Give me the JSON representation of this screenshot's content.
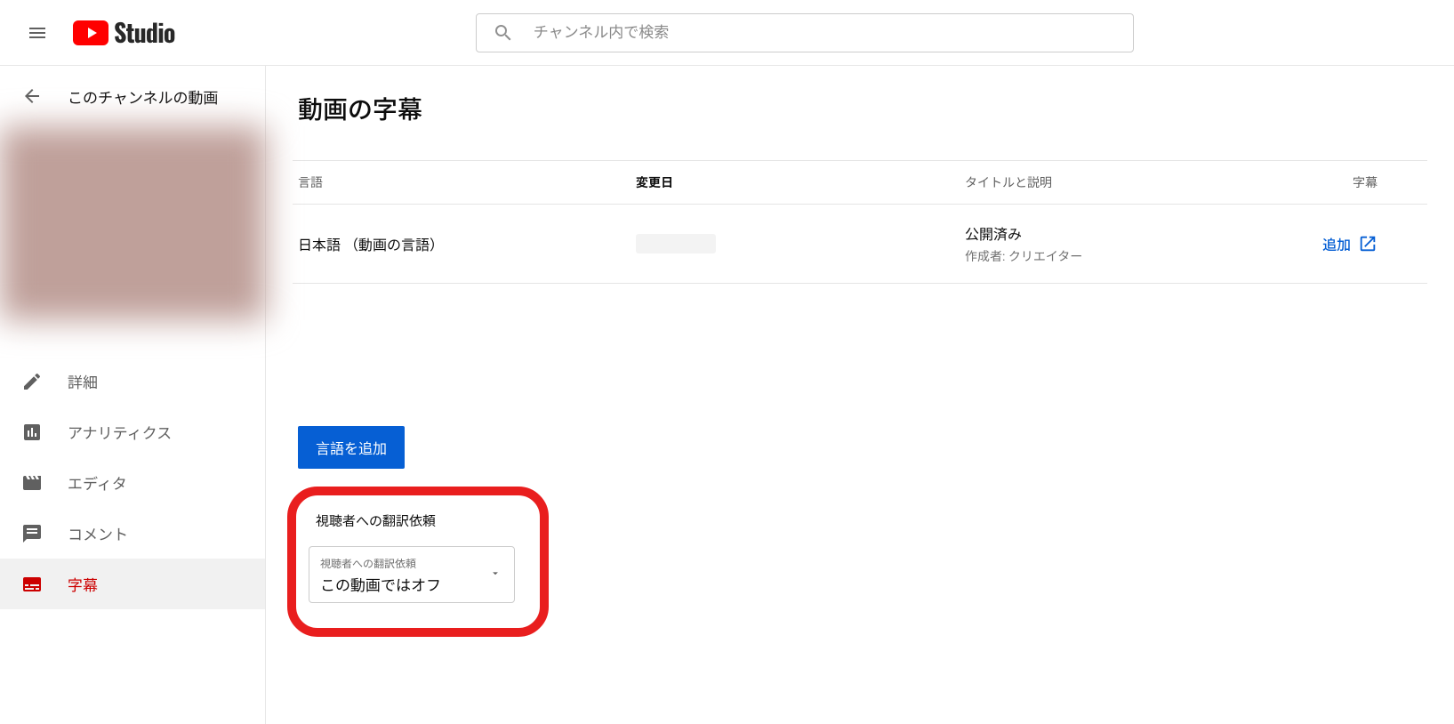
{
  "header": {
    "logo_text": "Studio",
    "search_placeholder": "チャンネル内で検索"
  },
  "sidebar": {
    "back_label": "このチャンネルの動画",
    "items": [
      {
        "label": "詳細",
        "icon": "pencil-icon",
        "active": false
      },
      {
        "label": "アナリティクス",
        "icon": "analytics-icon",
        "active": false
      },
      {
        "label": "エディタ",
        "icon": "editor-icon",
        "active": false
      },
      {
        "label": "コメント",
        "icon": "comment-icon",
        "active": false
      },
      {
        "label": "字幕",
        "icon": "subtitles-icon",
        "active": true
      }
    ]
  },
  "main": {
    "title": "動画の字幕",
    "columns": {
      "lang": "言語",
      "date": "変更日",
      "title_desc": "タイトルと説明",
      "subtitles": "字幕"
    },
    "rows": [
      {
        "language": "日本語 （動画の言語）",
        "title_status": "公開済み",
        "title_author": "作成者: クリエイター",
        "subtitle_action": "追加"
      }
    ],
    "add_language_button": "言語を追加",
    "community_section": {
      "heading": "視聴者への翻訳依頼",
      "select_label": "視聴者への翻訳依頼",
      "select_value": "この動画ではオフ"
    }
  }
}
